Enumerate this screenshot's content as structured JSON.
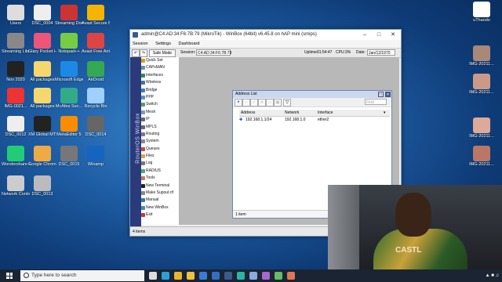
{
  "desktop_icons": [
    {
      "label": "Users"
    },
    {
      "label": "DSC_0004"
    },
    {
      "label": "Streaming Downloa..."
    },
    {
      "label": "Avast Secure Browser"
    },
    {
      "label": "Streaming Library v..."
    },
    {
      "label": "Glary Pocket Hub"
    },
    {
      "label": "Notepad++"
    },
    {
      "label": "Avast Free Antivirus"
    },
    {
      "label": "Nov 2020"
    },
    {
      "label": "All packages"
    },
    {
      "label": "Microsoft Edge"
    },
    {
      "label": "AirDroid"
    },
    {
      "label": "IMG-0021..."
    },
    {
      "label": "All packages"
    },
    {
      "label": "McAfee Sec..."
    },
    {
      "label": "Recycle Bin"
    },
    {
      "label": "DSC_0012"
    },
    {
      "label": "XM Global MT5"
    },
    {
      "label": "MetaEditor 5"
    },
    {
      "label": "DSC_0014"
    },
    {
      "label": "Wondershare Filmora X"
    },
    {
      "label": "Google Chrome"
    },
    {
      "label": "DSC_0015"
    },
    {
      "label": "Winamp"
    },
    {
      "label": "Network Control"
    },
    {
      "label": "DSC_0013"
    },
    {
      "label": "uThando"
    },
    {
      "label": "IMG-20211..."
    },
    {
      "label": "IMG-20211..."
    },
    {
      "label": "IMG-20211..."
    },
    {
      "label": "IMG-20211..."
    }
  ],
  "winbox": {
    "title": "admin@C4:AD:34:F6:7B:79 (MikroTik) - WinBox (64bit) v6.45.8 on hAP mini (smips)",
    "menu": [
      "Session",
      "Settings",
      "Dashboard"
    ],
    "toolbar": {
      "safe_mode": "Safe Mode",
      "session_label": "Session:",
      "session_value": "C4:AD:34:F6:7B:79",
      "uptime_label": "Uptime:",
      "uptime_value": "01:54:47",
      "cpu_label": "CPU:",
      "cpu_value": "3%",
      "date_label": "Date:",
      "date_value": "Jan/12/1970"
    },
    "side_text": "RouterOS WinBox",
    "menu_items": [
      {
        "label": "Quick Set",
        "color": "#d4a017"
      },
      {
        "label": "CAPsMAN",
        "color": "#6a8caf"
      },
      {
        "label": "Interfaces",
        "color": "#2e8b57"
      },
      {
        "label": "Wireless",
        "color": "#4a6fa5"
      },
      {
        "label": "Bridge",
        "color": "#3c7dbf"
      },
      {
        "label": "PPP",
        "color": "#5b8fc7"
      },
      {
        "label": "Switch",
        "color": "#5a9a6b"
      },
      {
        "label": "Mesh",
        "color": "#7a9ac0"
      },
      {
        "label": "IP",
        "color": "#666"
      },
      {
        "label": "MPLS",
        "color": "#666"
      },
      {
        "label": "Routing",
        "color": "#8b6a9a"
      },
      {
        "label": "System",
        "color": "#888"
      },
      {
        "label": "Queues",
        "color": "#c44"
      },
      {
        "label": "Files",
        "color": "#d9a443"
      },
      {
        "label": "Log",
        "color": "#777"
      },
      {
        "label": "RADIUS",
        "color": "#4a7"
      },
      {
        "label": "Tools",
        "color": "#c75"
      },
      {
        "label": "New Terminal",
        "color": "#222"
      },
      {
        "label": "Make Supout.rif",
        "color": "#888"
      },
      {
        "label": "Manual",
        "color": "#37a"
      },
      {
        "label": "New WinBox",
        "color": "#48b"
      },
      {
        "label": "Exit",
        "color": "#c33"
      }
    ],
    "status": "4 items"
  },
  "address_list": {
    "title": "Address List",
    "find_placeholder": "Find",
    "columns": [
      "Address",
      "Network",
      "Interface"
    ],
    "rows": [
      {
        "address": "192.168.1.1/24",
        "network": "192.168.1.0",
        "interface": "ether2"
      }
    ],
    "footer": "1 item"
  },
  "webcam": {
    "shirt_text": "CASTL"
  },
  "taskbar": {
    "search_placeholder": "Type here to search",
    "apps": [
      {
        "name": "task-view",
        "color": "#ddd"
      },
      {
        "name": "edge",
        "color": "#2aa0d8"
      },
      {
        "name": "chrome",
        "color": "#e8b52e"
      },
      {
        "name": "file-explorer",
        "color": "#f0c040"
      },
      {
        "name": "store",
        "color": "#3a7bd5"
      },
      {
        "name": "mail",
        "color": "#2f6fc6"
      },
      {
        "name": "winbox",
        "color": "#3b5b8c"
      },
      {
        "name": "filmora",
        "color": "#2bb3a5"
      },
      {
        "name": "app-a",
        "color": "#8ad"
      },
      {
        "name": "app-b",
        "color": "#a6c"
      },
      {
        "name": "app-c",
        "color": "#6b6"
      },
      {
        "name": "app-d",
        "color": "#d75"
      }
    ]
  }
}
